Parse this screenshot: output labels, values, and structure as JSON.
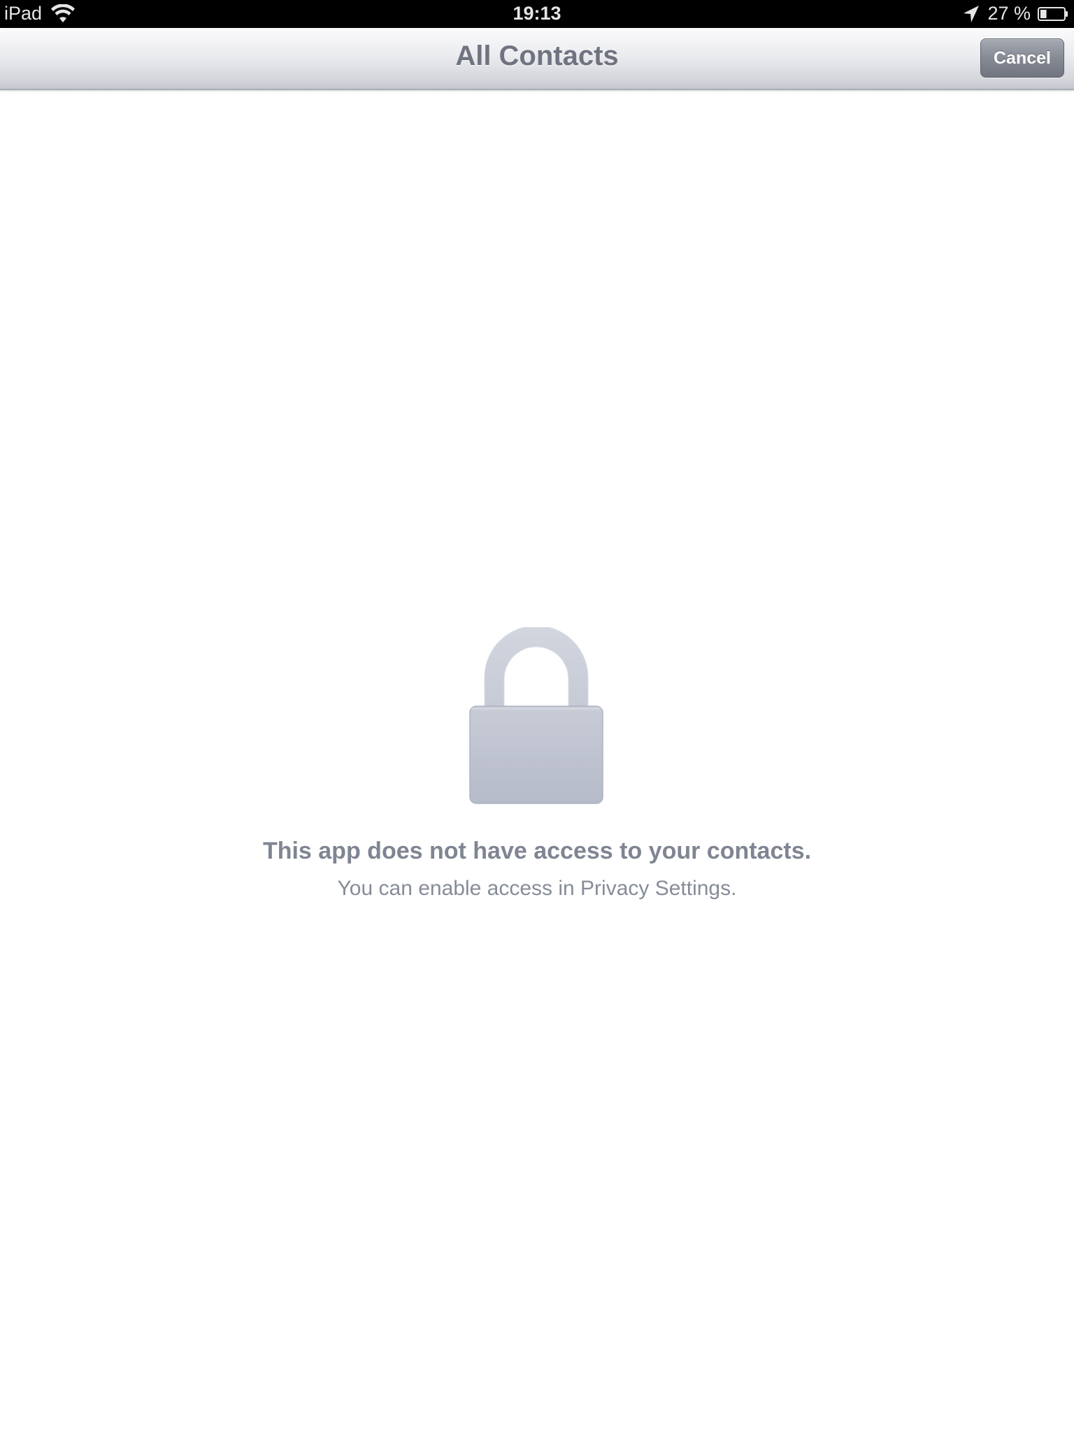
{
  "status_bar": {
    "device": "iPad",
    "time": "19:13",
    "battery_percent": "27 %",
    "battery_level": 0.27,
    "icons": [
      "wifi-icon",
      "location-arrow-icon",
      "battery-icon"
    ]
  },
  "nav_bar": {
    "title": "All Contacts",
    "cancel_label": "Cancel"
  },
  "content": {
    "icon": "lock-icon",
    "title": "This app does not have access to your contacts.",
    "subtitle": "You can enable access in Privacy Settings."
  },
  "colors": {
    "lock_fill": "#c2c6d2",
    "text_primary": "#7f8592",
    "nav_title": "#6f7480",
    "cancel_button": "#858a94"
  }
}
